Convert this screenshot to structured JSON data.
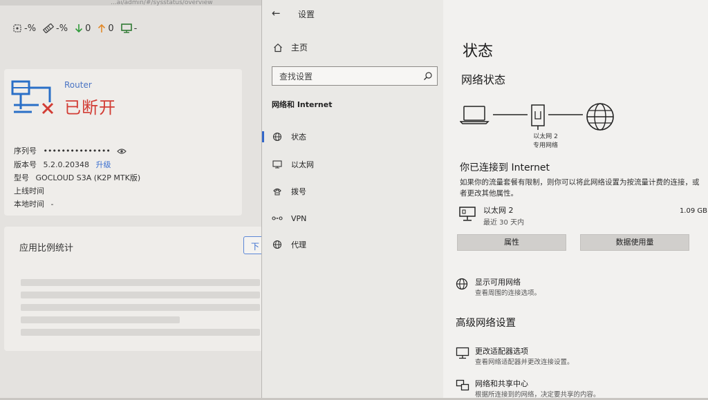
{
  "router_page": {
    "url_fragment": "...ai/admin/#/sysstatus/overview",
    "status_bar": {
      "cpu": "-%",
      "memory": "-%",
      "download": "0",
      "upload": "0",
      "connection": "-"
    },
    "router": {
      "name": "Router",
      "state": "已断开",
      "serial_label": "序列号",
      "serial_value": "•••••••••••••••",
      "version_label": "版本号",
      "version_value": "5.2.0.20348",
      "upgrade_link": "升级",
      "model_label": "型号",
      "model_value": "GOCLOUD S3A (K2P MTK版)",
      "uptime_label": "上线时间",
      "local_time_label": "本地时间",
      "local_time_value": "-"
    },
    "usage": {
      "title": "应用比例统计",
      "button_label": "下"
    }
  },
  "settings": {
    "window_title": "设置",
    "back_glyph": "←",
    "home_label": "主页",
    "search_placeholder": "查找设置",
    "section_title": "网络和 Internet",
    "nav_items": [
      {
        "label": "状态"
      },
      {
        "label": "以太网"
      },
      {
        "label": "拨号"
      },
      {
        "label": "VPN"
      },
      {
        "label": "代理"
      }
    ],
    "content": {
      "page_title": "状态",
      "net_status_title": "网络状态",
      "adapter_label_line1": "以太网 2",
      "adapter_label_line2": "专用网络",
      "connected_title": "你已连接到 Internet",
      "connected_desc": "如果你的流量套餐有限制，则你可以将此网络设置为按流量计费的连接，或者更改其他属性。",
      "adapter_name": "以太网 2",
      "adapter_period": "最近 30 天内",
      "adapter_usage": "1.09 GB",
      "properties_button": "属性",
      "data_usage_button": "数据使用量",
      "show_networks_title": "显示可用网络",
      "show_networks_sub": "查看周围的连接选项。",
      "advanced_title": "高级网络设置",
      "change_adapter_title": "更改适配器选项",
      "change_adapter_sub": "查看网络适配器并更改连接设置。",
      "sharing_center_title": "网络和共享中心",
      "sharing_center_sub": "根据所连接到的网络，决定要共享的内容。"
    }
  },
  "colors": {
    "accent": "#3367c9",
    "disconnected_red": "#d23c34",
    "link_blue": "#3a6fd0",
    "download_green": "#2f9a3a",
    "upload_orange": "#e28a2a"
  }
}
